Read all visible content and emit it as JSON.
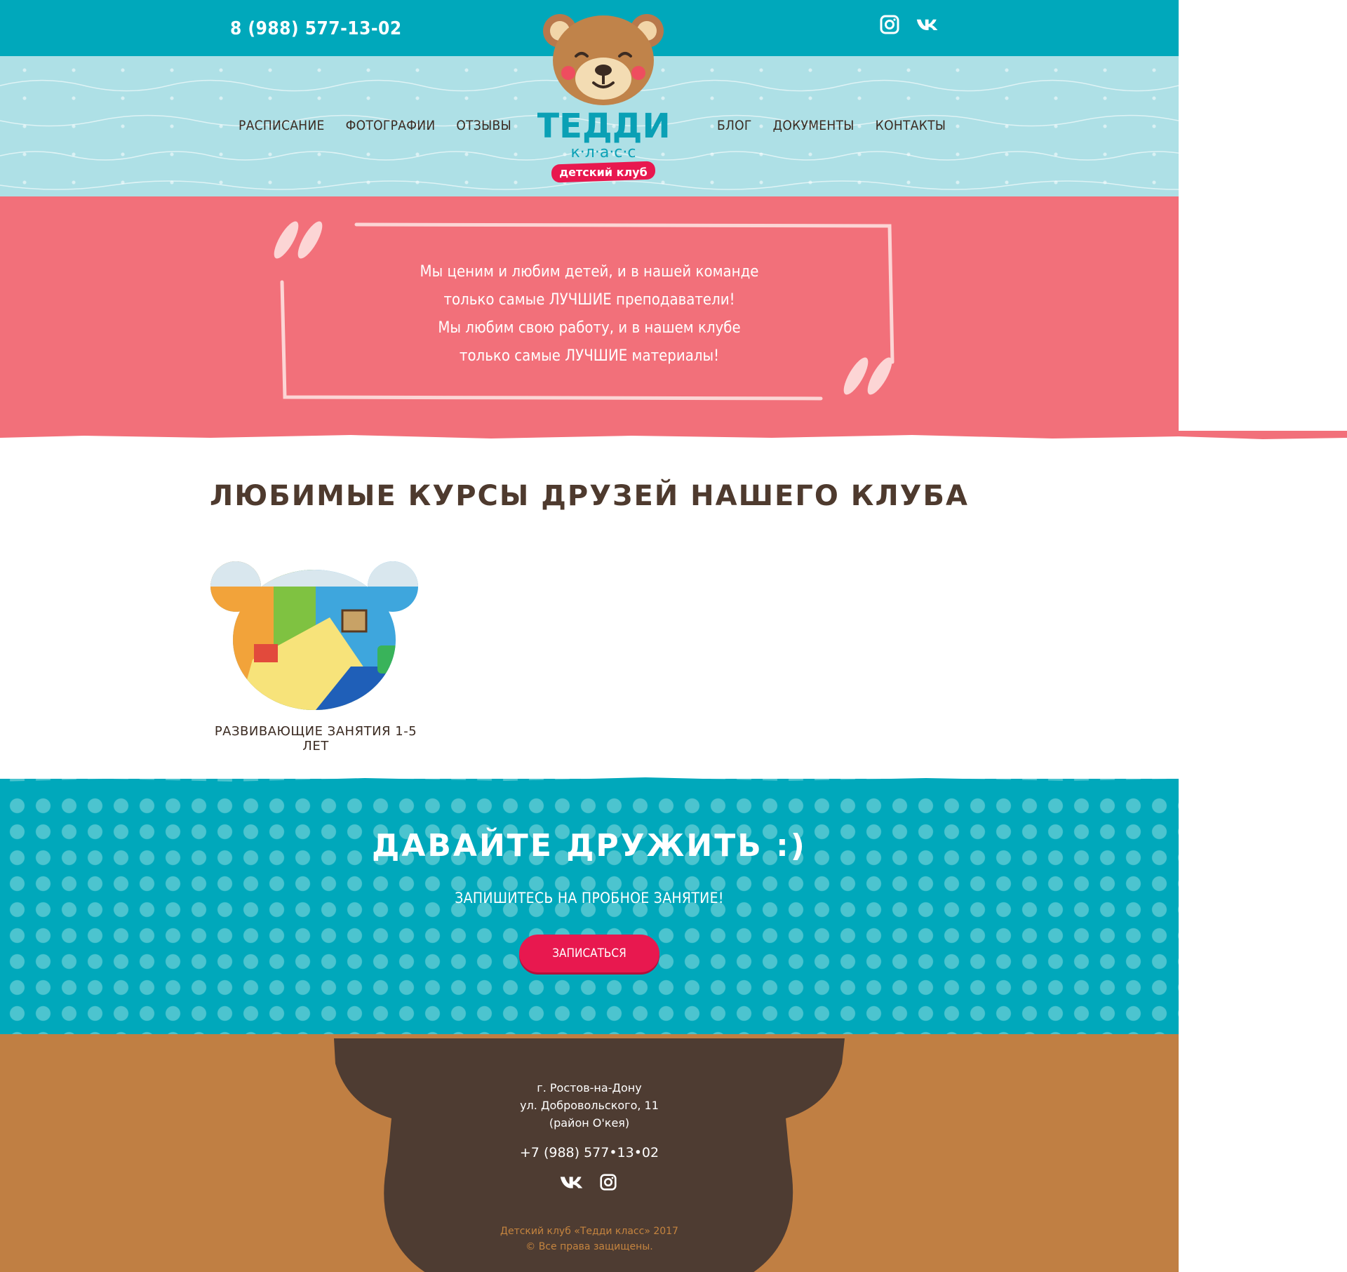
{
  "header": {
    "phone": "8 (988) 577-13-02",
    "social": [
      {
        "icon": "instagram-icon"
      },
      {
        "icon": "vk-icon"
      }
    ],
    "nav_left": [
      "РАСПИСАНИЕ",
      "ФОТОГРАФИИ",
      "ОТЗЫВЫ"
    ],
    "nav_right": [
      "БЛОГ",
      "ДОКУМЕНТЫ",
      "КОНТАКТЫ"
    ],
    "logo": {
      "title": "ТЕДДИ",
      "subtitle": "к·л·а·с·с",
      "badge": "детский клуб"
    }
  },
  "quote": {
    "lines": [
      "Мы ценим и любим детей, и в нашей команде",
      "только самые ЛУЧШИЕ преподаватели!",
      "Мы любим свою работу, и в нашем клубе",
      "только самые ЛУЧШИЕ материалы!"
    ]
  },
  "courses": {
    "title": "ЛЮБИМЫЕ КУРСЫ ДРУЗЕЙ НАШЕГО КЛУБА",
    "items": [
      {
        "label": "РАЗВИВАЮЩИЕ ЗАНЯТИЯ 1-5 ЛЕТ"
      }
    ]
  },
  "cta": {
    "title": "ДАВАЙТЕ ДРУЖИТЬ :)",
    "subtitle": "ЗАПИШИТЕСЬ НА ПРОБНОЕ ЗАНЯТИЕ!",
    "button": "ЗАПИСАТЬСЯ"
  },
  "footer": {
    "address": [
      "г. Ростов-на-Дону",
      "ул. Добровольского, 11",
      "(район О'кея)"
    ],
    "phone": "+7 (988) 577•13•02",
    "social": [
      {
        "icon": "vk-icon"
      },
      {
        "icon": "instagram-icon"
      }
    ],
    "copyright": [
      "Детский клуб «Тедди класс» 2017",
      "© Все права защищены."
    ]
  },
  "colors": {
    "teal": "#00a8bb",
    "light_teal": "#aee0e6",
    "coral": "#f2707a",
    "brown_dark": "#4e3a2e",
    "brown_light": "#c07f43",
    "accent_red": "#e8184f"
  }
}
